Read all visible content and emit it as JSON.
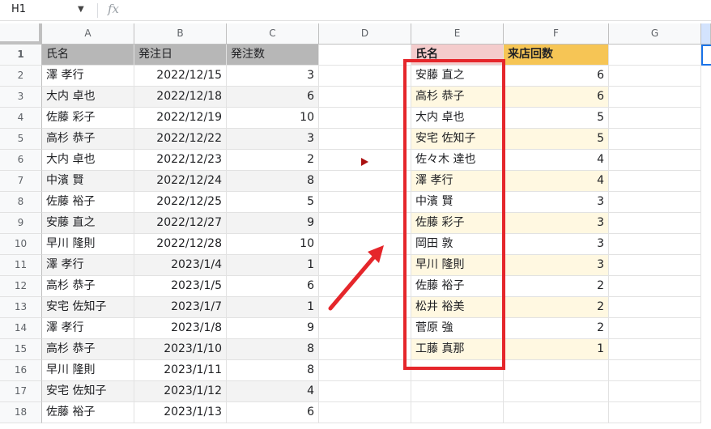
{
  "formula_bar": {
    "name_box": "H1",
    "fx_icon": "fx"
  },
  "columns": [
    "A",
    "B",
    "C",
    "D",
    "E",
    "F",
    "G"
  ],
  "rows": [
    "1",
    "2",
    "3",
    "4",
    "5",
    "6",
    "7",
    "8",
    "9",
    "10",
    "11",
    "12",
    "13",
    "14",
    "15",
    "16",
    "17",
    "18"
  ],
  "table_left": {
    "headers": [
      "氏名",
      "発注日",
      "発注数"
    ],
    "rows": [
      [
        "澤 孝行",
        "2022/12/15",
        "3"
      ],
      [
        "大内 卓也",
        "2022/12/18",
        "6"
      ],
      [
        "佐藤 彩子",
        "2022/12/19",
        "10"
      ],
      [
        "高杉 恭子",
        "2022/12/22",
        "3"
      ],
      [
        "大内 卓也",
        "2022/12/23",
        "2"
      ],
      [
        "中濱 賢",
        "2022/12/24",
        "8"
      ],
      [
        "佐藤 裕子",
        "2022/12/25",
        "5"
      ],
      [
        "安藤 直之",
        "2022/12/27",
        "9"
      ],
      [
        "早川 隆則",
        "2022/12/28",
        "10"
      ],
      [
        "澤 孝行",
        "2023/1/4",
        "1"
      ],
      [
        "高杉 恭子",
        "2023/1/5",
        "6"
      ],
      [
        "安宅 佐知子",
        "2023/1/7",
        "1"
      ],
      [
        "澤 孝行",
        "2023/1/8",
        "9"
      ],
      [
        "高杉 恭子",
        "2023/1/10",
        "8"
      ],
      [
        "早川 隆則",
        "2023/1/11",
        "8"
      ],
      [
        "安宅 佐知子",
        "2023/1/12",
        "4"
      ],
      [
        "佐藤 裕子",
        "2023/1/13",
        "6"
      ]
    ]
  },
  "table_right": {
    "headers": [
      "氏名",
      "来店回数"
    ],
    "rows": [
      [
        "安藤 直之",
        "6"
      ],
      [
        "高杉 恭子",
        "6"
      ],
      [
        "大内 卓也",
        "5"
      ],
      [
        "安宅 佐知子",
        "5"
      ],
      [
        "佐々木 達也",
        "4"
      ],
      [
        "澤 孝行",
        "4"
      ],
      [
        "中濱 賢",
        "3"
      ],
      [
        "佐藤 彩子",
        "3"
      ],
      [
        "岡田 敦",
        "3"
      ],
      [
        "早川 隆則",
        "3"
      ],
      [
        "佐藤 裕子",
        "2"
      ],
      [
        "松井 裕美",
        "2"
      ],
      [
        "菅原 強",
        "2"
      ],
      [
        "工藤 真那",
        "1"
      ]
    ]
  },
  "colors": {
    "highlight_box": "#e5262b",
    "arrow": "#e5262b",
    "header_a": "#b7b7b7",
    "header_e": "#f4cccc",
    "header_f": "#f6c555"
  }
}
